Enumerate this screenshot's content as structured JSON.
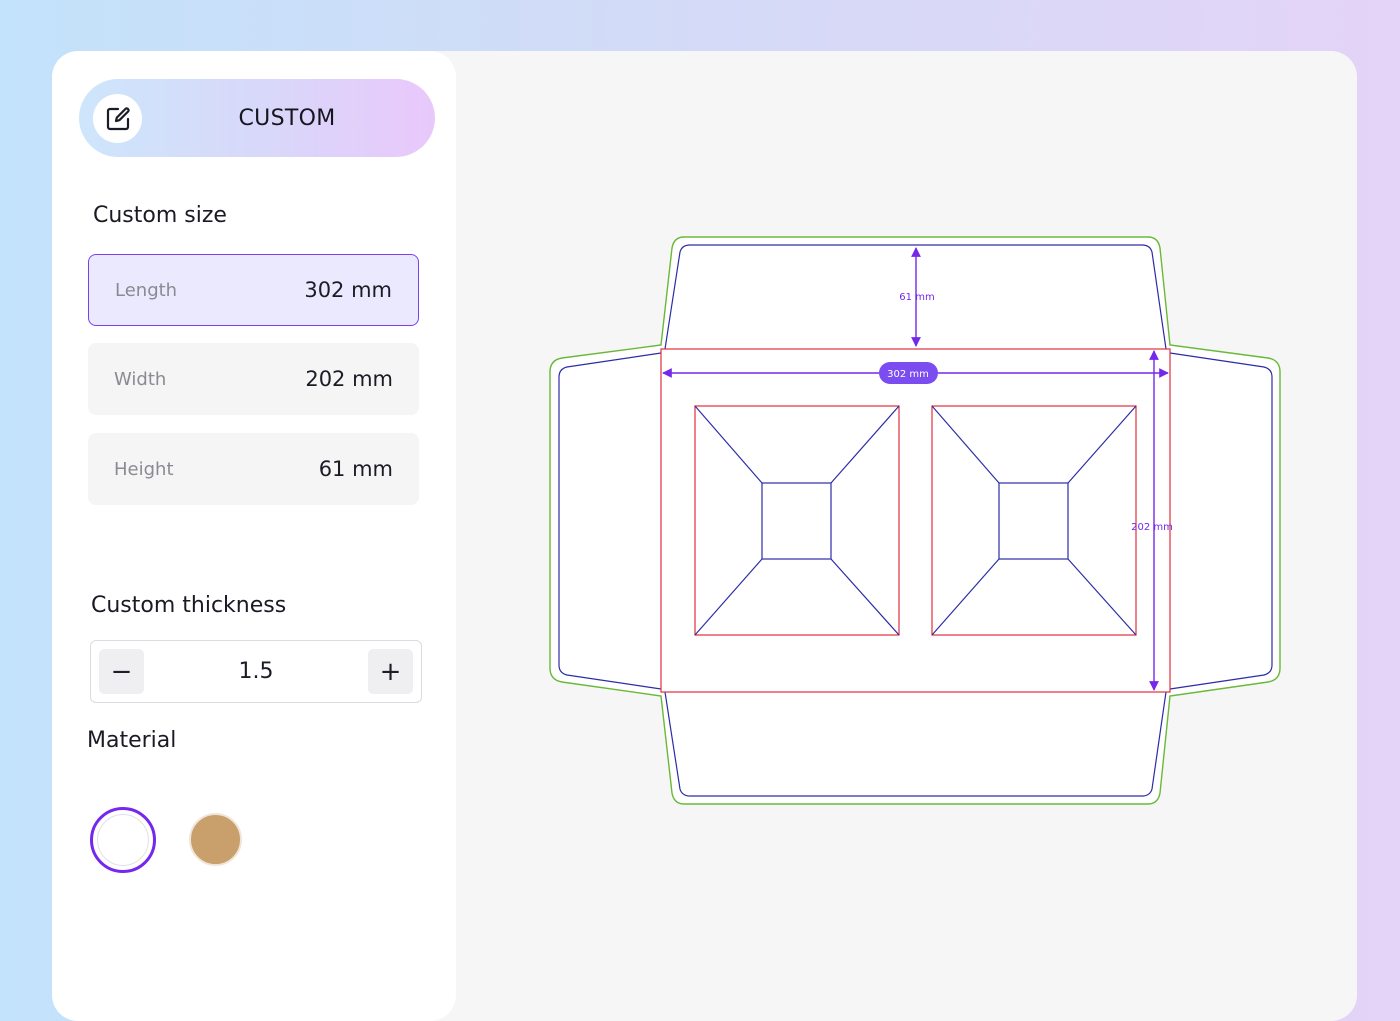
{
  "mode": {
    "label": "CUSTOM",
    "icon": "edit-icon"
  },
  "custom_size": {
    "title": "Custom size",
    "fields": [
      {
        "label": "Length",
        "value": "302 mm"
      },
      {
        "label": "Width",
        "value": "202 mm"
      },
      {
        "label": "Height",
        "value": "61 mm"
      }
    ]
  },
  "custom_thickness": {
    "title": "Custom thickness",
    "value": "1.5",
    "decrement_label": "−",
    "increment_label": "+"
  },
  "material": {
    "title": "Material",
    "options": [
      {
        "name": "white",
        "color": "#ffffff",
        "selected": true
      },
      {
        "name": "kraft",
        "color": "#c9a06c",
        "selected": false
      }
    ]
  },
  "dieline": {
    "height_label": "61 mm",
    "length_label": "302 mm",
    "width_label": "202 mm",
    "colors": {
      "cut": "#6ab83a",
      "fold": "#2c2ca8",
      "panel": "#e0303c",
      "dimension": "#7428ec"
    }
  }
}
